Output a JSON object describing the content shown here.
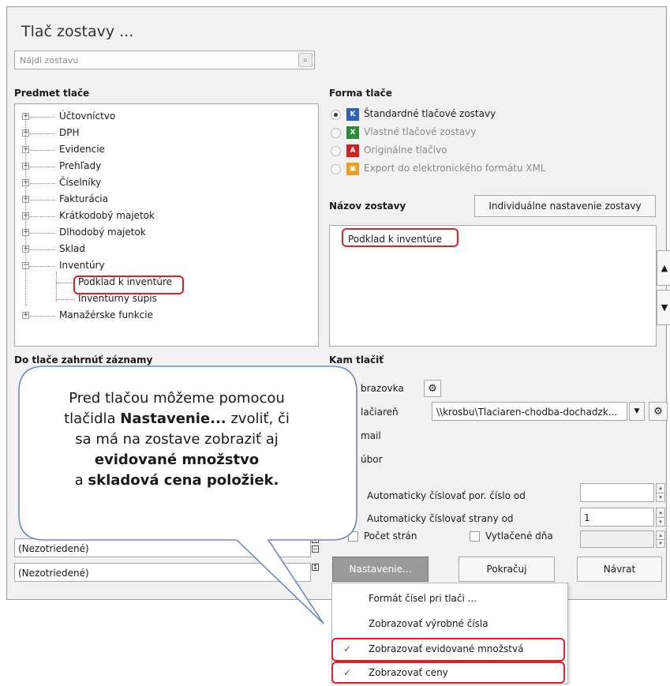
{
  "title": "Tlač zostavy ...",
  "search": {
    "placeholder": "Nájdi zostavu"
  },
  "left": {
    "heading": "Predmet tlače",
    "tree": [
      {
        "label": "Účtovníctvo",
        "expander": "+"
      },
      {
        "label": "DPH",
        "expander": "+"
      },
      {
        "label": "Evidencie",
        "expander": "+"
      },
      {
        "label": "Prehľady",
        "expander": "+"
      },
      {
        "label": "Číselníky",
        "expander": "+"
      },
      {
        "label": "Fakturácia",
        "expander": "+"
      },
      {
        "label": "Krátkodobý majetok",
        "expander": "+"
      },
      {
        "label": "Dlhodobý majetok",
        "expander": "+"
      },
      {
        "label": "Sklad",
        "expander": "+"
      },
      {
        "label": "Inventúry",
        "expander": "−"
      },
      {
        "label": "Podklad k inventúre",
        "expander": ""
      },
      {
        "label": "Inventúrny súpis",
        "expander": ""
      },
      {
        "label": "Manažérske funkcie",
        "expander": "+"
      }
    ],
    "include_heading": "Do tlače zahrnúť záznamy",
    "sort1": "(Nezotriedené)",
    "sort2": "(Nezotriedené)"
  },
  "right": {
    "form_heading": "Forma tlače",
    "forms": [
      {
        "label": "Štandardné tlačové zostavy",
        "icon": "kros-icon"
      },
      {
        "label": "Vlastné tlačové zostavy",
        "icon": "excel-icon"
      },
      {
        "label": "Originálne tlačivo",
        "icon": "pdf-icon"
      },
      {
        "label": "Export do elektronického formátu XML",
        "icon": "xml-export-icon"
      }
    ],
    "name_heading": "Názov zostavy",
    "individual_button": "Individuálne nastavenie zostavy",
    "report_name": "Podklad k inventúre",
    "where_heading": "Kam tlačiť",
    "targets": [
      "Obrazovka",
      "Tlačiareň",
      "E-mail",
      "Súbor"
    ],
    "targets_visible": [
      "brazovka",
      "lačiareň",
      "mail",
      "úbor"
    ],
    "printer": "\\\\krosbu\\Tlaciaren-chodba-dochadzk...",
    "auto_number_label": "Automaticky číslovať por. číslo od",
    "auto_pages_label": "Automaticky číslovať strany od",
    "auto_pages_value": "1",
    "page_count_label": "Počet strán",
    "printed_day_label": "Vytlačené dňa"
  },
  "buttons": {
    "settings": "Nastavenie...",
    "continue": "Pokračuj",
    "back": "Návrat"
  },
  "menu": {
    "items": [
      {
        "label": "Formát čísel pri tlači ...",
        "checked": false
      },
      {
        "label": "Zobrazovať výrobné čísla",
        "checked": false
      },
      {
        "label": "Zobrazovať evidované množstvá",
        "checked": true
      },
      {
        "label": "Zobrazovať ceny",
        "checked": true
      }
    ]
  },
  "callout": {
    "line1": "Pred tlačou môžeme pomocou",
    "line2a": "tlačidla ",
    "line2b": "Nastavenie...",
    "line2c": " zvoliť, či",
    "line3": "sa má na zostave zobraziť aj",
    "line4": "evidované množstvo",
    "line5a": "a ",
    "line5b": "skladová cena položiek."
  },
  "colors": {
    "highlight": "#e0202a",
    "callout_border": "#6b8cc0"
  }
}
